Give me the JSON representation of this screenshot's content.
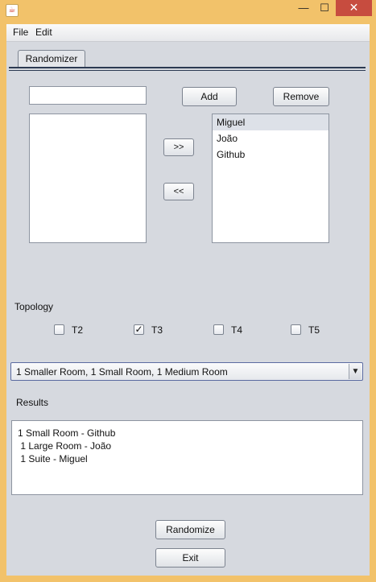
{
  "window": {
    "icon": "java-icon",
    "controls": {
      "minimize": "—",
      "maximize": "☐",
      "close": "✕"
    }
  },
  "menu": {
    "items": [
      {
        "label": "File"
      },
      {
        "label": "Edit"
      }
    ]
  },
  "tabs": [
    {
      "label": "Randomizer"
    }
  ],
  "input": {
    "value": "",
    "placeholder": ""
  },
  "buttons": {
    "add": "Add",
    "remove": "Remove",
    "move_right": ">>",
    "move_left": "<<",
    "randomize": "Randomize",
    "exit": "Exit"
  },
  "left_list": {
    "items": []
  },
  "right_list": {
    "items": [
      {
        "label": "Miguel",
        "selected": true
      },
      {
        "label": "João",
        "selected": false
      },
      {
        "label": "Github",
        "selected": false
      }
    ]
  },
  "topology": {
    "label": "Topology",
    "options": [
      {
        "label": "T2",
        "checked": false
      },
      {
        "label": "T3",
        "checked": true
      },
      {
        "label": "T4",
        "checked": false
      },
      {
        "label": "T5",
        "checked": false
      }
    ]
  },
  "combo": {
    "selected": "1 Smaller Room, 1 Small Room, 1 Medium Room",
    "arrow": "▼"
  },
  "results": {
    "label": "Results",
    "lines": [
      "1 Small Room - Github",
      " 1 Large Room - João",
      " 1 Suite - Miguel"
    ]
  },
  "colors": {
    "window_frame": "#f2c26a",
    "panel_background": "#d6d9df",
    "close_button": "#c74c3f",
    "selection": "#dde1e8"
  }
}
